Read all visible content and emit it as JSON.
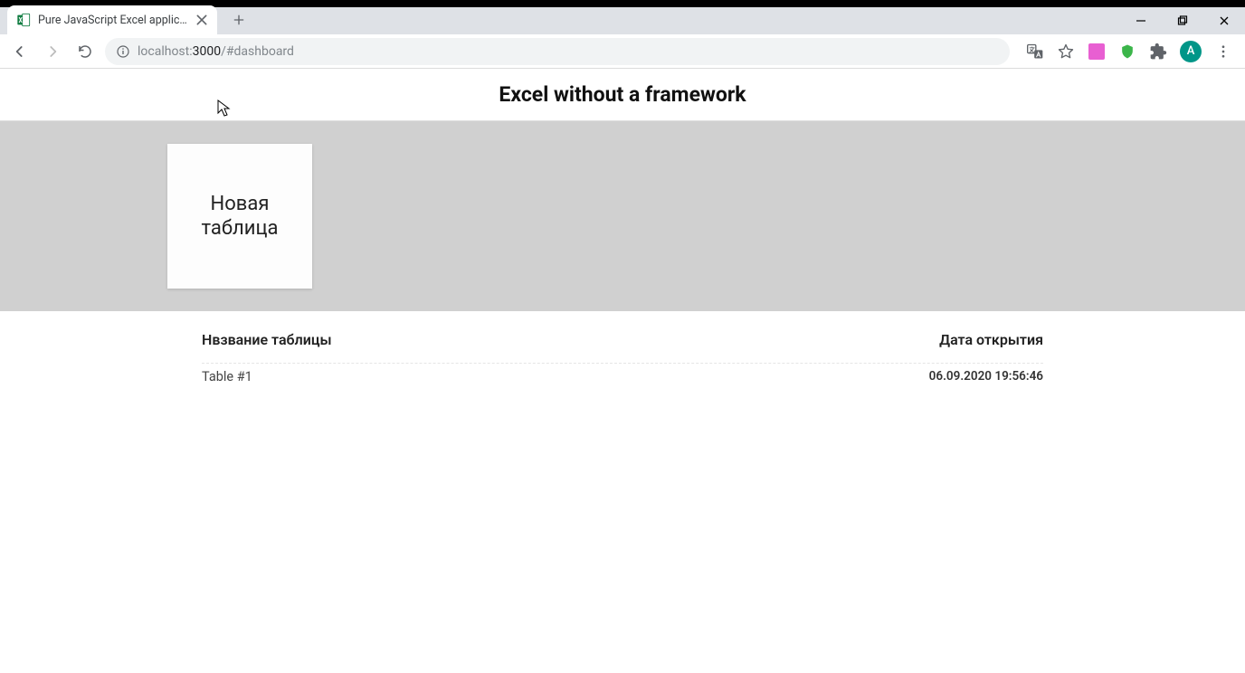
{
  "browser": {
    "tab_title": "Pure JavaScript Excel application",
    "url_host": "localhost:",
    "url_port": "3000",
    "url_path": "/#dashboard",
    "avatar_letter": "A"
  },
  "page": {
    "title": "Excel without a framework",
    "new_table_label": "Новая\nтаблица",
    "columns": {
      "name": "Нвзвание таблицы",
      "date": "Дата открытия"
    },
    "tables": [
      {
        "name": "Table #1",
        "opened": "06.09.2020 19:56:46"
      }
    ]
  },
  "icons": {
    "ext_pink": "#e85fd2",
    "ext_green": "#3bb54a"
  }
}
